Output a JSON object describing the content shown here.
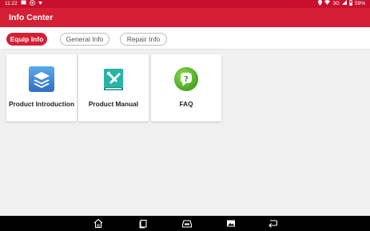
{
  "status_bar": {
    "time": "11:22",
    "left_icons": [
      "notification-icon",
      "app-icon",
      "signal-dropdown-icon"
    ],
    "network": "3G",
    "battery": "59%"
  },
  "app_bar": {
    "title": "Info Center"
  },
  "tabs": [
    {
      "label": "Equip Info",
      "active": true
    },
    {
      "label": "General Info",
      "active": false
    },
    {
      "label": "Repair Info",
      "active": false
    }
  ],
  "cards": [
    {
      "label": "Product Introduction",
      "icon": "layers-icon"
    },
    {
      "label": "Product Manual",
      "icon": "tools-book-icon"
    },
    {
      "label": "FAQ",
      "icon": "question-icon"
    }
  ],
  "nav_bar": {
    "buttons": [
      "home-icon",
      "recents-icon",
      "vci-icon",
      "screenshot-icon",
      "back-icon"
    ]
  },
  "colors": {
    "brand_red": "#d51f34",
    "status_red": "#c8102e",
    "background": "#f0f0f0"
  }
}
